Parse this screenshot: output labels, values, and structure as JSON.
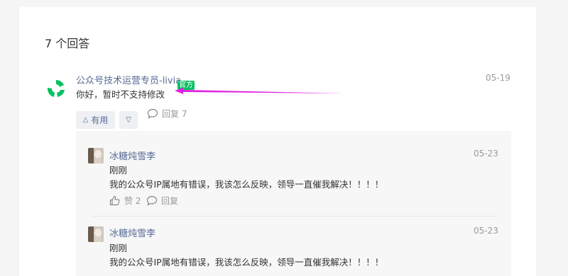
{
  "answers": {
    "count_title": "7 个回答"
  },
  "main_answer": {
    "author": "公众号技术运营专员-livia",
    "badge": "官方",
    "date": "05-19",
    "content": "你好，暂时不支持修改",
    "useful_label": "有用",
    "reply_label": "回复 7"
  },
  "replies": [
    {
      "author": "冰糖炖雪李",
      "date": "05-23",
      "line1": "刚刚",
      "line2": "我的公众号IP属地有错误，我该怎么反映，领导一直催我解决！！！！",
      "like_label": "赞 2",
      "reply_label": "回复"
    },
    {
      "author": "冰糖炖雪李",
      "date": "05-23",
      "line1": "刚刚",
      "line2": "我的公众号IP属地有错误，我该怎么反映，领导一直催我解决！！！！"
    }
  ],
  "colors": {
    "accent": "#07c160",
    "link": "#576b95",
    "arrow": "#e020e0"
  }
}
